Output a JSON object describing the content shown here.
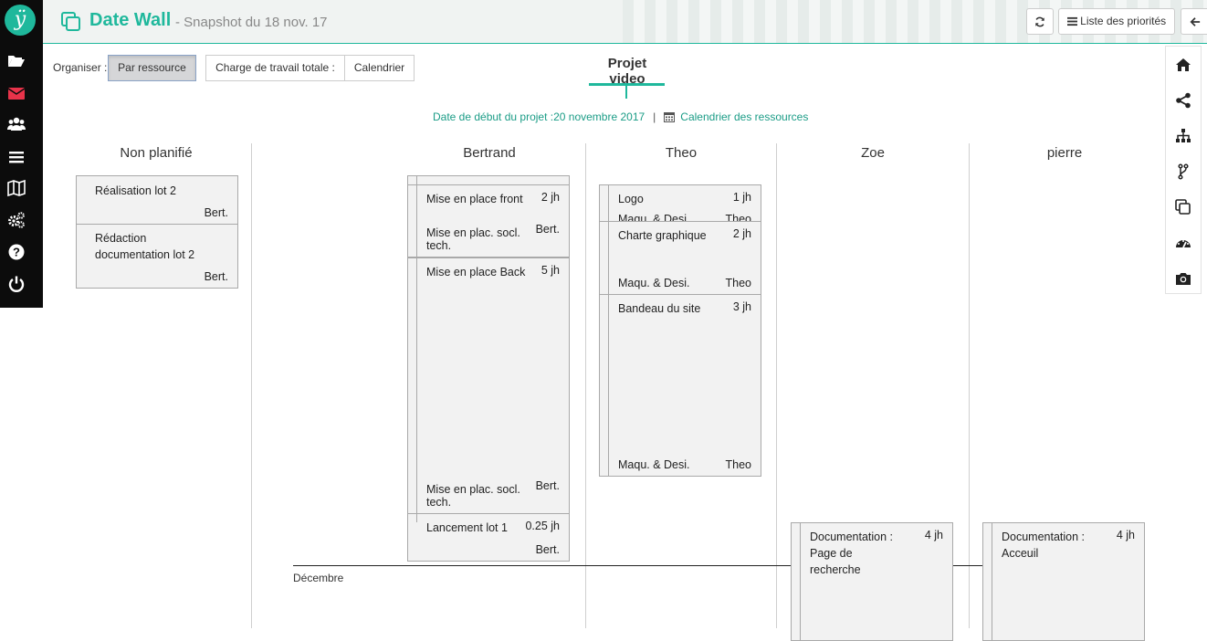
{
  "header": {
    "title": "Date Wall",
    "subtitle": "- Snapshot du 18 nov. 17",
    "priority_button": "Liste des priorités"
  },
  "toolbar": {
    "organize_label": "Organiser :",
    "by_resource": "Par ressource",
    "total_workload": "Charge de travail totale :",
    "calendar": "Calendrier"
  },
  "project": {
    "name": "Projet video",
    "start_date": "Date de début du projet :20 novembre 2017",
    "separator": "|",
    "resource_calendar": "Calendrier des ressources"
  },
  "columns": [
    "Non planifié",
    "Bertrand",
    "Theo",
    "Zoe",
    "pierre"
  ],
  "unplanned": [
    {
      "name": "Réalisation lot 2",
      "res": "Bert."
    },
    {
      "name": "Rédaction documentation lot 2",
      "res": "Bert."
    }
  ],
  "bertrand": [
    {
      "name": "Mise en place front",
      "dur": "2 jh",
      "phase": "Mise en plac. socl. tech.",
      "res": "Bert."
    },
    {
      "name": "Mise en place Back",
      "dur": "5 jh",
      "phase": "Mise en plac. socl. tech.",
      "res": "Bert."
    },
    {
      "name": "Lancement lot 1",
      "dur": "0.25 jh",
      "res": "Bert."
    }
  ],
  "theo": [
    {
      "name": "Logo",
      "dur": "1 jh",
      "phase": "Maqu. & Desi.",
      "res": "Theo"
    },
    {
      "name": "Charte graphique",
      "dur": "2 jh",
      "phase": "Maqu. & Desi.",
      "res": "Theo"
    },
    {
      "name": "Bandeau du site",
      "dur": "3 jh",
      "phase": "Maqu. & Desi.",
      "res": "Theo"
    }
  ],
  "zoe": [
    {
      "name": "Documentation : Page de recherche",
      "dur": "4 jh"
    }
  ],
  "pierre": [
    {
      "name": "Documentation : Acceuil",
      "dur": "4 jh"
    }
  ],
  "timeline": {
    "month": "Décembre"
  },
  "colors": {
    "accent": "#1fb89c",
    "sidebar": "#0c0c0c",
    "card": "#f2f2f2"
  }
}
